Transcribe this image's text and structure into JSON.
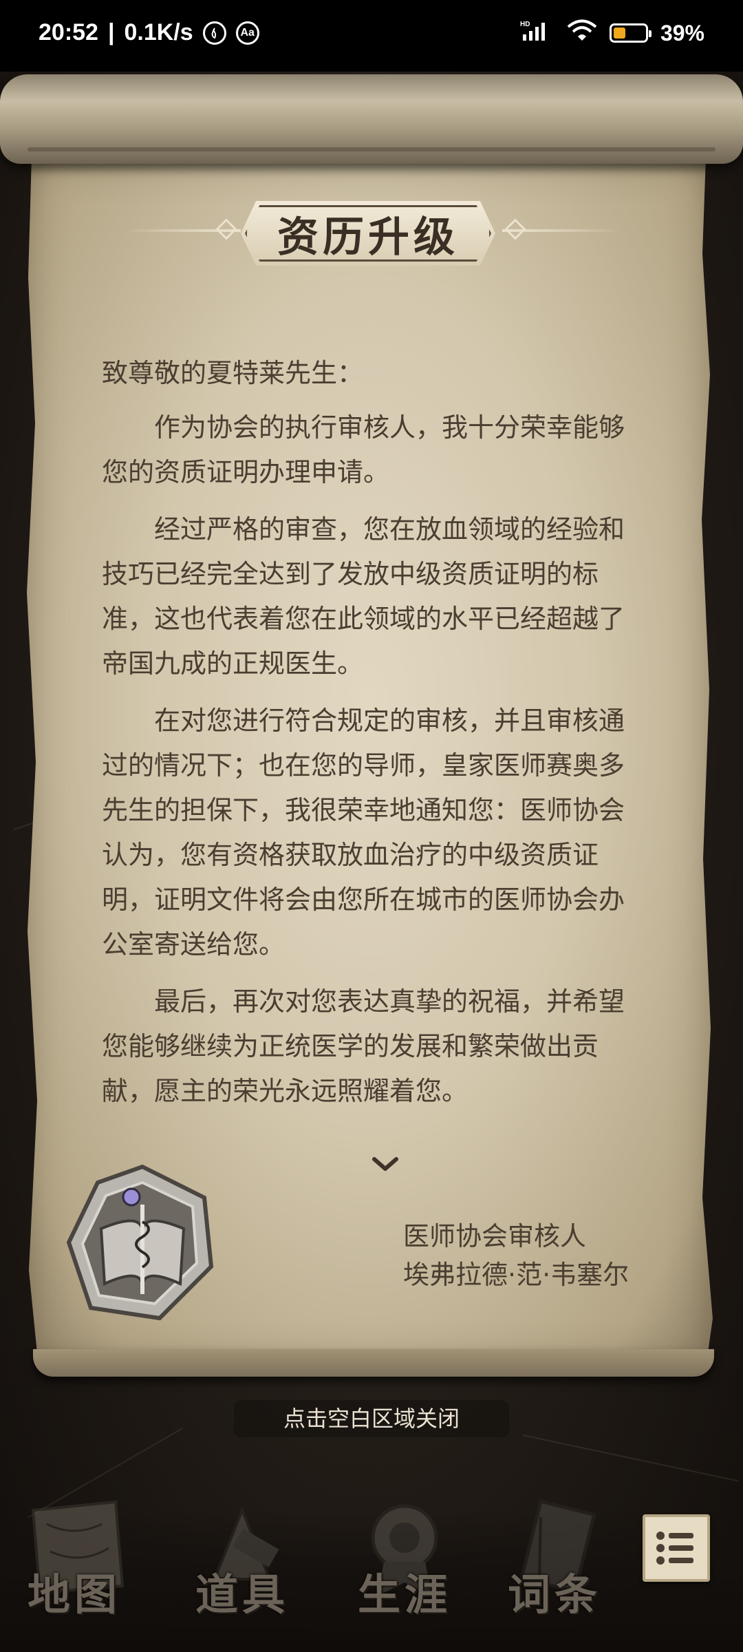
{
  "status_bar": {
    "time": "20:52",
    "speed": "0.1K/s",
    "left_icons": [
      "flame-icon",
      "aa-icon"
    ],
    "network": "HD",
    "battery_percent": "39",
    "battery_level": 0.39,
    "battery_color": "#f0a81e"
  },
  "dialog": {
    "title": "资历升级",
    "greeting": "致尊敬的夏特莱先生：",
    "paragraphs": [
      "作为协会的执行审核人，我十分荣幸能够您的资质证明办理申请。",
      "经过严格的审查，您在放血领域的经验和技巧已经完全达到了发放中级资质证明的标准，这也代表着您在此领域的水平已经超越了帝国九成的正规医生。",
      "在对您进行符合规定的审核，并且审核通过的情况下；也在您的导师，皇家医师赛奥多先生的担保下，我很荣幸地通知您：医师协会认为，您有资格获取放血治疗的中级资质证明，证明文件将会由您所在城市的医师协会办公室寄送给您。",
      "最后，再次对您表达真挚的祝福，并希望您能够继续为正统医学的发展和繁荣做出贡献，愿主的荣光永远照耀着您。"
    ],
    "signature_title": "医师协会审核人",
    "signature_name": "埃弗拉德·范·韦塞尔",
    "close_hint": "点击空白区域关闭"
  },
  "nav": {
    "items": [
      {
        "label": "地图",
        "icon": "map-icon"
      },
      {
        "label": "道具",
        "icon": "items-icon"
      },
      {
        "label": "生涯",
        "icon": "career-medal-icon"
      },
      {
        "label": "词条",
        "icon": "glossary-book-icon"
      }
    ],
    "menu_icon": "list-menu-icon"
  }
}
